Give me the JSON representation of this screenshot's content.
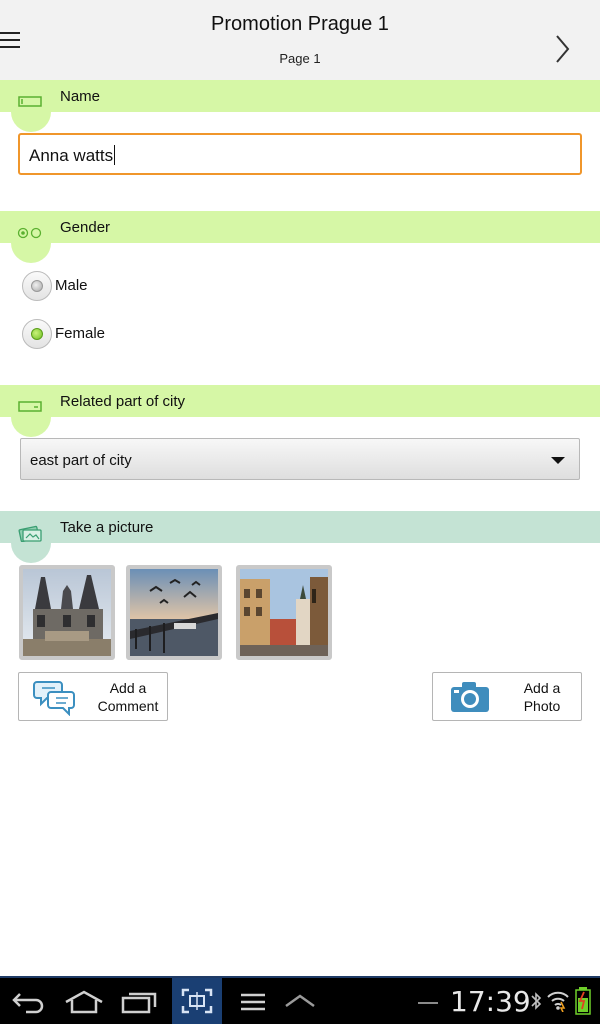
{
  "header": {
    "title": "Promotion Prague 1",
    "subtitle": "Page 1"
  },
  "sections": {
    "name": {
      "label": "Name",
      "value": "Anna watts"
    },
    "gender": {
      "label": "Gender",
      "options": [
        {
          "label": "Male",
          "selected": false
        },
        {
          "label": "Female",
          "selected": true
        }
      ]
    },
    "city": {
      "label": "Related part of city",
      "selected": "east part of city"
    },
    "picture": {
      "label": "Take a picture",
      "thumbnails": [
        "prague-church-photo",
        "birds-over-bridge-photo",
        "old-town-street-photo"
      ]
    }
  },
  "actions": {
    "comment": {
      "line1": "Add a",
      "line2": "Comment"
    },
    "photo": {
      "line1": "Add a",
      "line2": "Photo"
    }
  },
  "system": {
    "time": "17:39",
    "icons": [
      "back-icon",
      "home-icon",
      "recent-apps-icon",
      "screenshot-icon",
      "menu-icon",
      "up-arrow-icon",
      "bluetooth-icon",
      "wifi-icon",
      "battery-icon"
    ]
  },
  "colors": {
    "section_green": "#d6f7a6",
    "section_teal": "#c4e3d4",
    "input_focus": "#f0962b",
    "radio_selected": "#6fbf22"
  }
}
